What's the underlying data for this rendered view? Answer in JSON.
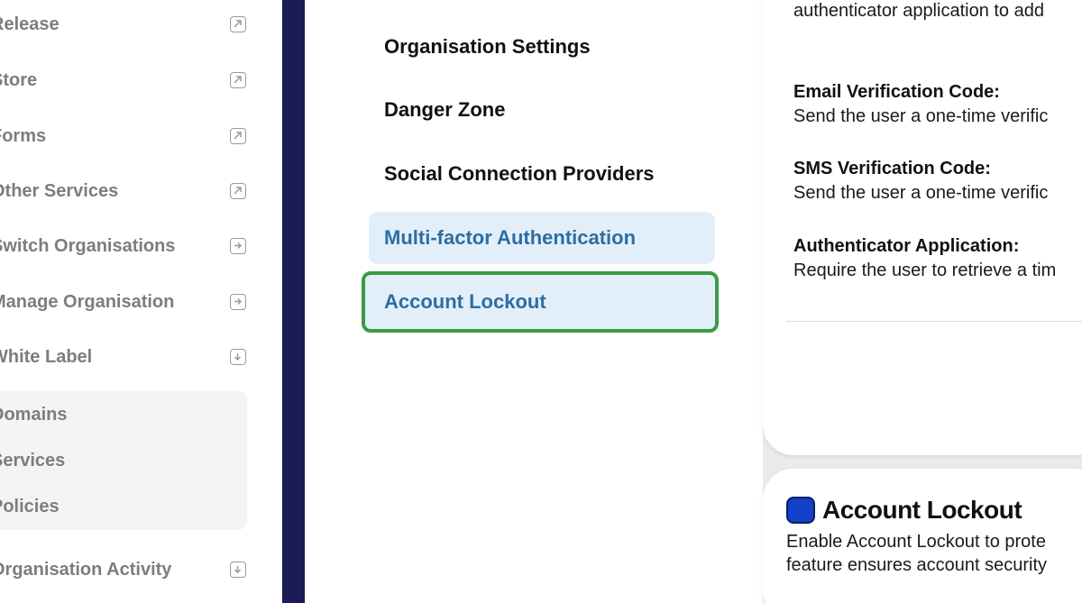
{
  "sidebar": {
    "items": [
      {
        "label": "Release",
        "icon": "external-link-icon"
      },
      {
        "label": "Store",
        "icon": "external-link-icon"
      },
      {
        "label": "Forms",
        "icon": "external-link-icon"
      },
      {
        "label": "Other Services",
        "icon": "external-link-icon"
      },
      {
        "label": "Switch Organisations",
        "icon": "arrow-right-icon"
      },
      {
        "label": "Manage Organisation",
        "icon": "arrow-right-icon"
      },
      {
        "label": "White Label",
        "icon": "arrow-down-icon"
      }
    ],
    "subitems": [
      {
        "label": "Domains"
      },
      {
        "label": "Services"
      },
      {
        "label": "Policies"
      }
    ],
    "bottom_item": {
      "label": "Organisation Activity",
      "icon": "arrow-down-icon"
    }
  },
  "settings_menu": {
    "items": [
      {
        "label": "Organisation Settings"
      },
      {
        "label": "Danger Zone"
      },
      {
        "label": "Social Connection Providers"
      },
      {
        "label": "Multi-factor Authentication"
      },
      {
        "label": "Account Lockout"
      }
    ]
  },
  "mfa_card": {
    "intro": "authenticator application to add",
    "email_title": "Email Verification Code:",
    "email_desc": "Send the user a one-time verific",
    "sms_title": "SMS Verification Code:",
    "sms_desc": "Send the user a one-time verific",
    "auth_title": "Authenticator Application:",
    "auth_desc": "Require the user to retrieve a tim"
  },
  "lockout_card": {
    "title": "Account Lockout",
    "line1": "Enable Account Lockout to prote",
    "line2": "feature ensures account security"
  },
  "colors": {
    "navy": "#1b1b55",
    "accent_blue": "#2c6ea4",
    "highlight_green": "#3a9b46"
  }
}
